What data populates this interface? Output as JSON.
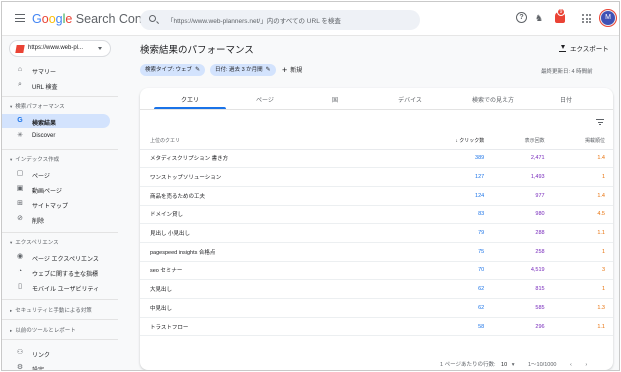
{
  "header": {
    "app_title": {
      "g1": "G",
      "g2": "o",
      "g3": "o",
      "g4": "g",
      "g5": "l",
      "g6": "e",
      "rest": " Search Console"
    },
    "search_placeholder": "「https://www.web-planners.net/」内のすべての URL を検査",
    "notification_count": "9",
    "avatar_letter": "M"
  },
  "sidebar": {
    "property": "https://www.web-pl...",
    "items": [
      {
        "icon": "home-icon",
        "glyph": "⌂",
        "label": "サマリー"
      },
      {
        "icon": "search-icon",
        "glyph": "⌕",
        "label": "URL 検査"
      }
    ],
    "section_performance": "検索パフォーマンス",
    "perf_items": [
      {
        "icon": "google-g-icon",
        "glyph": "G",
        "label": "検索結果"
      },
      {
        "icon": "asterisk-icon",
        "glyph": "✳",
        "label": "Discover"
      }
    ],
    "section_index": "インデックス作成",
    "index_items": [
      {
        "icon": "page-icon",
        "glyph": "▢",
        "label": "ページ"
      },
      {
        "icon": "video-page-icon",
        "glyph": "▣",
        "label": "動画ページ"
      },
      {
        "icon": "sitemap-icon",
        "glyph": "⊞",
        "label": "サイトマップ"
      },
      {
        "icon": "removal-icon",
        "glyph": "⊘",
        "label": "削除"
      }
    ],
    "section_experience": "エクスペリエンス",
    "experience_items": [
      {
        "icon": "page-experience-icon",
        "glyph": "◉",
        "label": "ページ エクスペリエンス"
      },
      {
        "icon": "web-vitals-icon",
        "glyph": "◔",
        "label": "ウェブに関する主な指標"
      },
      {
        "icon": "mobile-icon",
        "glyph": "▯",
        "label": "モバイル ユーザビリティ"
      }
    ],
    "section_security": "セキュリティと手動による対策",
    "section_legacy": "以前のツールとレポート",
    "bottom_items": [
      {
        "icon": "links-icon",
        "glyph": "⚇",
        "label": "リンク"
      },
      {
        "icon": "settings-icon",
        "glyph": "⚙",
        "label": "設定"
      }
    ]
  },
  "main": {
    "title": "検索結果のパフォーマンス",
    "export_label": "エクスポート",
    "chips": [
      "検索タイプ: ウェブ",
      "日付: 過去 3 か月間"
    ],
    "new_label": "新規",
    "updated": "最終更新日: 4 時間前",
    "tabs": [
      "クエリ",
      "ページ",
      "国",
      "デバイス",
      "検索での見え方",
      "日付"
    ],
    "columns": {
      "query": "上位のクエリ",
      "clicks": "クリック数",
      "impressions": "表示回数",
      "position": "掲載順位"
    },
    "rows": [
      {
        "query": "メタディスクリプション 書き方",
        "clicks": "389",
        "impressions": "2,471",
        "position": "1.4"
      },
      {
        "query": "ワンストップソリューション",
        "clicks": "127",
        "impressions": "1,493",
        "position": "1"
      },
      {
        "query": "商品を売るための工夫",
        "clicks": "124",
        "impressions": "977",
        "position": "1.4"
      },
      {
        "query": "ドメイン貸し",
        "clicks": "83",
        "impressions": "980",
        "position": "4.5"
      },
      {
        "query": "見出し 小見出し",
        "clicks": "79",
        "impressions": "288",
        "position": "1.1"
      },
      {
        "query": "pagespeed insights 合格点",
        "clicks": "75",
        "impressions": "258",
        "position": "1"
      },
      {
        "query": "seo セミナー",
        "clicks": "70",
        "impressions": "4,519",
        "position": "3"
      },
      {
        "query": "大見出し",
        "clicks": "62",
        "impressions": "815",
        "position": "1"
      },
      {
        "query": "中見出し",
        "clicks": "62",
        "impressions": "585",
        "position": "1.3"
      },
      {
        "query": "トラストフロー",
        "clicks": "58",
        "impressions": "296",
        "position": "1.1"
      }
    ],
    "pager": {
      "rows_label": "1 ページあたりの行数:",
      "rows_value": "10",
      "range": "1〜10/1000"
    }
  }
}
